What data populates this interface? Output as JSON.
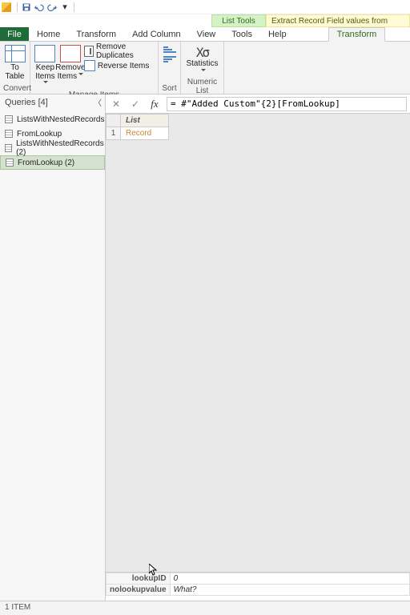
{
  "qat": {
    "save_title": "Save",
    "undo_title": "Undo",
    "redo_title": "Redo"
  },
  "contextual": {
    "tool_group": "List Tools",
    "window_title": "Extract Record Field values from"
  },
  "tabs": {
    "file": "File",
    "home": "Home",
    "transform": "Transform",
    "add_column": "Add Column",
    "view": "View",
    "tools": "Tools",
    "help": "Help",
    "ctx_transform": "Transform"
  },
  "ribbon": {
    "convert": {
      "title": "Convert",
      "to_table": "To\nTable"
    },
    "manage": {
      "title": "Manage Items",
      "keep": "Keep\nItems",
      "remove": "Remove\nItems",
      "remove_duplicates": "Remove Duplicates",
      "reverse_items": "Reverse Items"
    },
    "sort": {
      "title": "Sort"
    },
    "numeric": {
      "title": "Numeric List",
      "statistics": "Statistics"
    }
  },
  "queries": {
    "header": "Queries [4]",
    "items": [
      {
        "label": "ListsWithNestedRecords"
      },
      {
        "label": "FromLookup"
      },
      {
        "label": "ListsWithNestedRecords (2)"
      },
      {
        "label": "FromLookup (2)",
        "selected": true
      }
    ]
  },
  "formula": {
    "cancel": "✕",
    "commit": "✓",
    "fx": "fx",
    "value": "= #\"Added Custom\"{2}[FromLookup]"
  },
  "grid": {
    "col_header": "List",
    "rows": [
      {
        "n": "1",
        "value": "Record"
      }
    ]
  },
  "record": {
    "fields": [
      {
        "k": "lookupID",
        "v": "0"
      },
      {
        "k": "nolookupvalue",
        "v": "What?"
      }
    ]
  },
  "status": {
    "text": "1 ITEM"
  }
}
